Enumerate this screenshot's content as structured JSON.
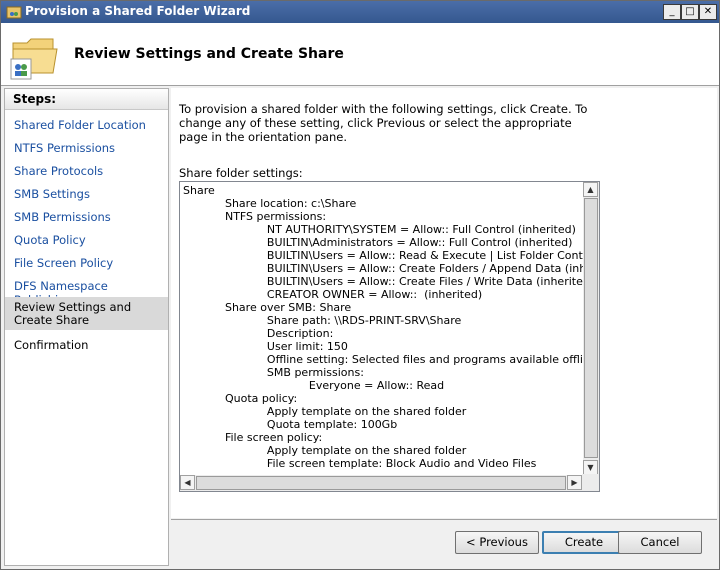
{
  "window": {
    "title": "Provision a Shared Folder Wizard",
    "minimize": "_",
    "maximize": "□",
    "close": "✕"
  },
  "header": {
    "title": "Review Settings and Create Share"
  },
  "steps": {
    "heading": "Steps:",
    "items": [
      {
        "label": "Shared Folder Location"
      },
      {
        "label": "NTFS Permissions"
      },
      {
        "label": "Share Protocols"
      },
      {
        "label": "SMB Settings"
      },
      {
        "label": "SMB Permissions"
      },
      {
        "label": "Quota Policy"
      },
      {
        "label": "File Screen Policy"
      },
      {
        "label": "DFS Namespace Publishing"
      },
      {
        "label": "Review Settings and Create Share"
      },
      {
        "label": "Confirmation"
      }
    ],
    "current_index": 8
  },
  "main": {
    "intro": "To provision a shared folder with the following settings, click Create. To change any of these setting, click Previous or select the appropriate page in the orientation pane.",
    "settings_label": "Share folder settings:",
    "settings_text": "Share\n\t\t\t\tShare location: c:\\Share\n\t\t\t\tNTFS permissions:\n\t\t\t\t\t\t\t\tNT AUTHORITY\\SYSTEM = Allow:: Full Control (inherited)\n\t\t\t\t\t\t\t\tBUILTIN\\Administrators = Allow:: Full Control (inherited)\n\t\t\t\t\t\t\t\tBUILTIN\\Users = Allow:: Read & Execute | List Folder Contents | \n\t\t\t\t\t\t\t\tBUILTIN\\Users = Allow:: Create Folders / Append Data (inherited\n\t\t\t\t\t\t\t\tBUILTIN\\Users = Allow:: Create Files / Write Data (inherited)\n\t\t\t\t\t\t\t\tCREATOR OWNER = Allow::  (inherited)\n\t\t\t\tShare over SMB: Share\n\t\t\t\t\t\t\t\tShare path: \\\\RDS-PRINT-SRV\\Share\n\t\t\t\t\t\t\t\tDescription:\n\t\t\t\t\t\t\t\tUser limit: 150\n\t\t\t\t\t\t\t\tOffline setting: Selected files and programs available offline\n\t\t\t\t\t\t\t\tSMB permissions:\n\t\t\t\t\t\t\t\t\t\t\t\tEveryone = Allow:: Read\n\t\t\t\tQuota policy:\n\t\t\t\t\t\t\t\tApply template on the shared folder\n\t\t\t\t\t\t\t\tQuota template: 100Gb\n\t\t\t\tFile screen policy:\n\t\t\t\t\t\t\t\tApply template on the shared folder\n\t\t\t\t\t\t\t\tFile screen template: Block Audio and Video Files"
  },
  "buttons": {
    "previous": "< Previous",
    "create": "Create",
    "cancel": "Cancel"
  },
  "colors": {
    "titlebar": "#3f639c",
    "link": "#1a4fa0",
    "selected_step": "#d9d9d9"
  }
}
